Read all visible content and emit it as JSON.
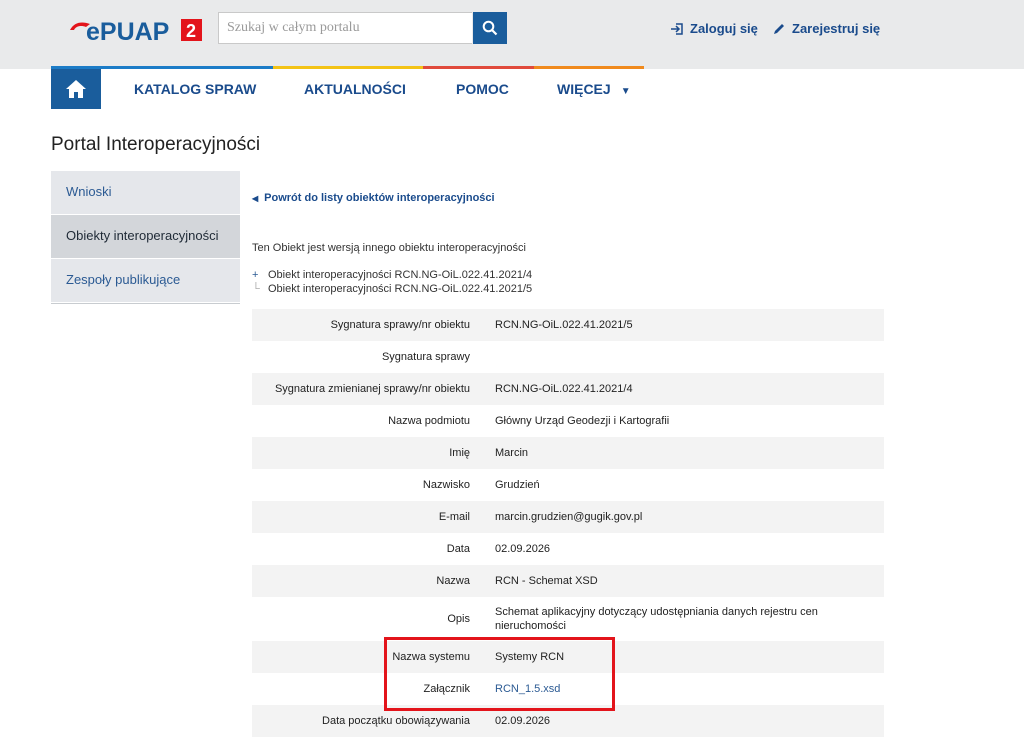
{
  "header": {
    "logo_alt": "ePUAP 2",
    "search_placeholder": "Szukaj w całym portalu",
    "login_label": "Zaloguj się",
    "register_label": "Zarejestruj się"
  },
  "nav": {
    "items": [
      "KATALOG SPRAW",
      "AKTUALNOŚCI",
      "POMOC",
      "WIĘCEJ"
    ]
  },
  "page_title": "Portal Interoperacyjności",
  "sidebar": {
    "items": [
      "Wnioski",
      "Obiekty interoperacyjności",
      "Zespoły publikujące"
    ],
    "active_index": 1
  },
  "content": {
    "back_link": "Powrót do listy obiektów interoperacyjności",
    "version_note": "Ten Obiekt jest wersją innego obiektu interoperacyjności",
    "tree": [
      "Obiekt interoperacyjności RCN.NG-OiL.022.41.2021/4",
      "Obiekt interoperacyjności RCN.NG-OiL.022.41.2021/5"
    ],
    "details": [
      {
        "label": "Sygnatura sprawy/nr obiektu",
        "value": "RCN.NG-OiL.022.41.2021/5"
      },
      {
        "label": "Sygnatura sprawy",
        "value": ""
      },
      {
        "label": "Sygnatura zmienianej sprawy/nr obiektu",
        "value": "RCN.NG-OiL.022.41.2021/4"
      },
      {
        "label": "Nazwa podmiotu",
        "value": "Główny Urząd Geodezji i Kartografii"
      },
      {
        "label": "Imię",
        "value": "Marcin"
      },
      {
        "label": "Nazwisko",
        "value": "Grudzień"
      },
      {
        "label": "E-mail",
        "value": "marcin.grudzien@gugik.gov.pl"
      },
      {
        "label": "Data",
        "value": "02.09.2026"
      },
      {
        "label": "Nazwa",
        "value": "RCN - Schemat XSD"
      },
      {
        "label": "Opis",
        "value": "Schemat aplikacyjny dotyczący udostępniania danych rejestru cen nieruchomości"
      },
      {
        "label": "Nazwa systemu",
        "value": "Systemy RCN"
      },
      {
        "label": "Załącznik",
        "value": "RCN_1.5.xsd"
      },
      {
        "label": "Data początku obowiązywania",
        "value": "02.09.2026"
      }
    ]
  },
  "colors": {
    "brand_blue": "#1a5d9c",
    "link_blue": "#1a4b8c",
    "logo_red": "#e3141b",
    "highlight_red": "#e3141b",
    "stripe": [
      "#1c7cc7",
      "#f3c316",
      "#e04a3c",
      "#f08a1d"
    ]
  }
}
